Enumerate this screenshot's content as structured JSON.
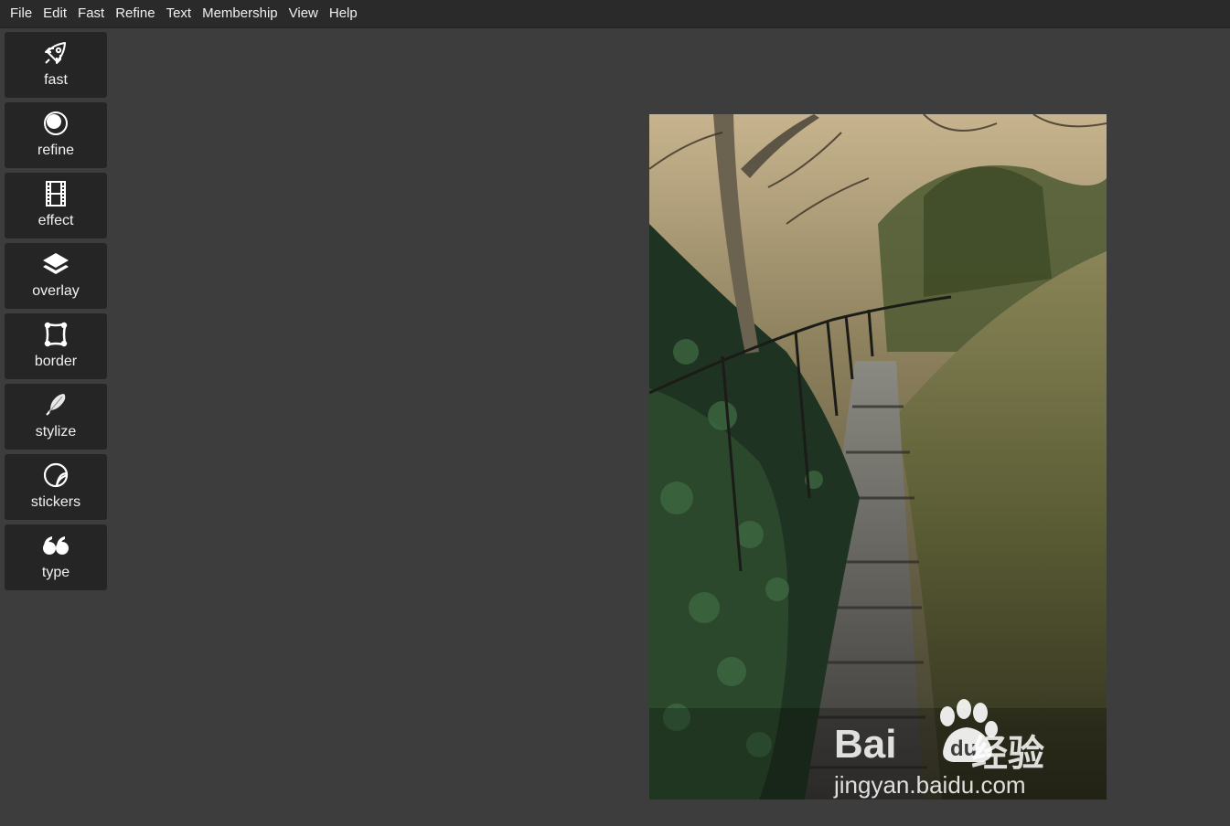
{
  "menu": [
    "File",
    "Edit",
    "Fast",
    "Refine",
    "Text",
    "Membership",
    "View",
    "Help"
  ],
  "tools": [
    {
      "label": "fast",
      "icon": "rocket-icon"
    },
    {
      "label": "refine",
      "icon": "circles-icon"
    },
    {
      "label": "effect",
      "icon": "film-icon"
    },
    {
      "label": "overlay",
      "icon": "layers-icon"
    },
    {
      "label": "border",
      "icon": "frame-icon"
    },
    {
      "label": "stylize",
      "icon": "feather-icon"
    },
    {
      "label": "stickers",
      "icon": "sticker-icon"
    },
    {
      "label": "type",
      "icon": "quote-icon"
    }
  ],
  "watermark": {
    "brand_bai": "Bai",
    "brand_du": "du",
    "brand_cn": "经验",
    "url": "jingyan.baidu.com"
  }
}
